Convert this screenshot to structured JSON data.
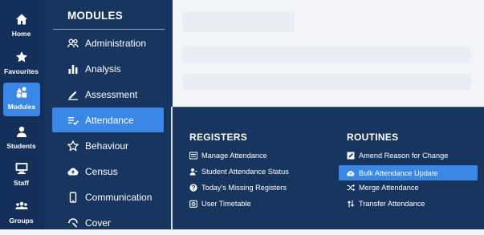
{
  "rail": {
    "items": [
      {
        "label": "Home",
        "icon": "home-icon"
      },
      {
        "label": "Favourites",
        "icon": "star-icon"
      },
      {
        "label": "Modules",
        "icon": "modules-icon",
        "active": true
      },
      {
        "label": "Students",
        "icon": "person-icon"
      },
      {
        "label": "Staff",
        "icon": "staff-icon"
      },
      {
        "label": "Groups",
        "icon": "groups-icon"
      }
    ]
  },
  "modules": {
    "title": "MODULES",
    "items": [
      {
        "label": "Administration",
        "icon": "people-icon"
      },
      {
        "label": "Analysis",
        "icon": "bar-chart-icon"
      },
      {
        "label": "Assessment",
        "icon": "pencil-icon"
      },
      {
        "label": "Attendance",
        "icon": "checklist-icon",
        "active": true
      },
      {
        "label": "Behaviour",
        "icon": "star-badge-icon"
      },
      {
        "label": "Census",
        "icon": "cloud-icon"
      },
      {
        "label": "Communication",
        "icon": "phone-icon"
      },
      {
        "label": "Cover",
        "icon": "cover-icon"
      }
    ]
  },
  "panel": {
    "registers": {
      "title": "REGISTERS",
      "items": [
        {
          "label": "Manage Attendance",
          "icon": "list-icon"
        },
        {
          "label": "Student Attendance Status",
          "icon": "user-status-icon"
        },
        {
          "label": "Today's Missing Registers",
          "icon": "question-icon"
        },
        {
          "label": "User Timetable",
          "icon": "timetable-icon"
        }
      ]
    },
    "routines": {
      "title": "ROUTINES",
      "items": [
        {
          "label": "Amend Reason for Change",
          "icon": "edit-icon"
        },
        {
          "label": "Bulk Attendance Update",
          "icon": "cloud-upload-icon",
          "active": true
        },
        {
          "label": "Merge Attendance",
          "icon": "shuffle-icon"
        },
        {
          "label": "Transfer Attendance",
          "icon": "transfer-icon"
        }
      ]
    }
  },
  "colors": {
    "rail_bg": "#14305a",
    "panel_bg": "#17355f",
    "accent": "#3b87e6"
  }
}
